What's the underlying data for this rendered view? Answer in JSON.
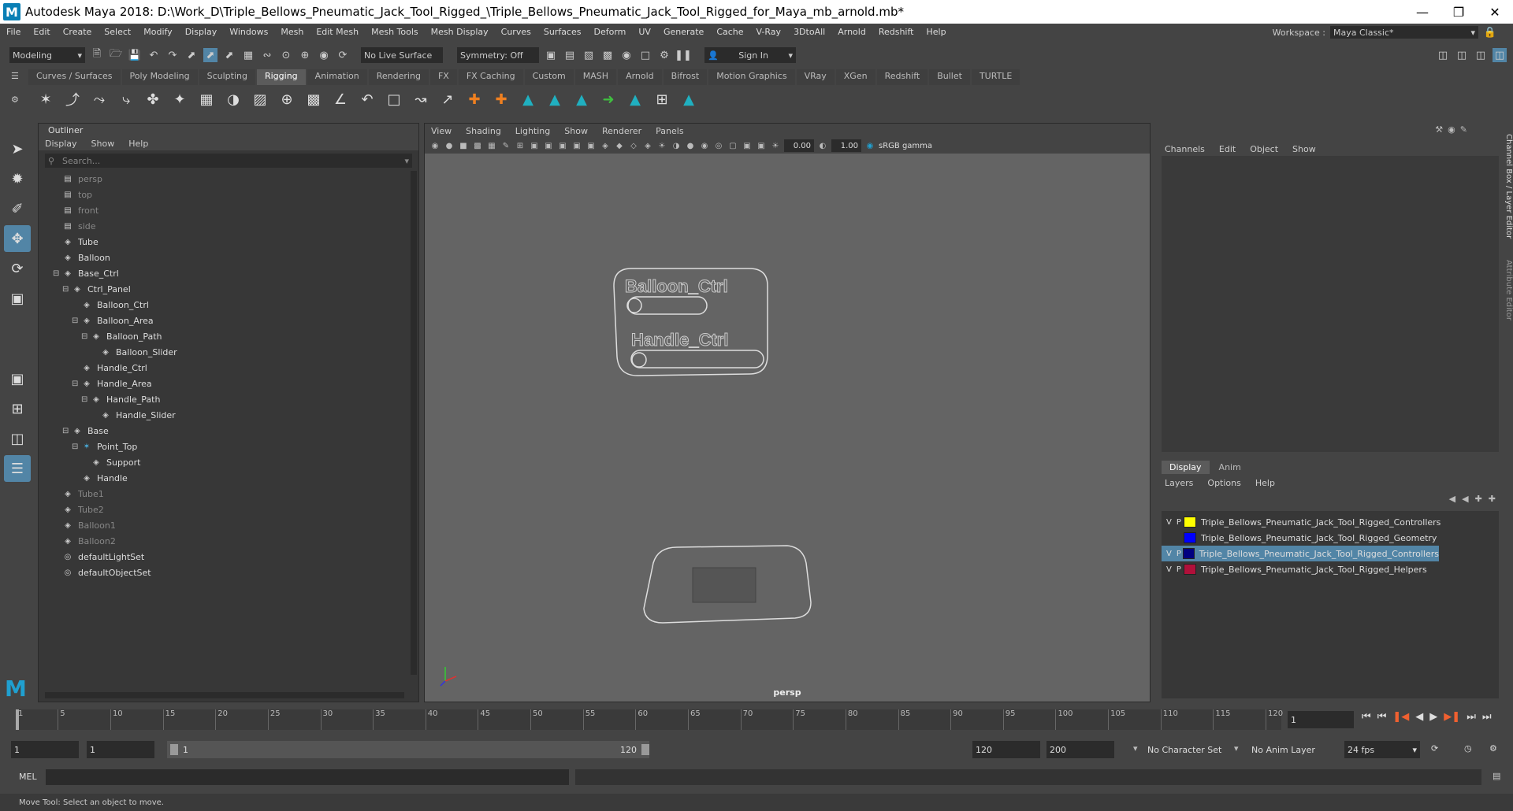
{
  "window": {
    "title": "Autodesk Maya 2018: D:\\Work_D\\Triple_Bellows_Pneumatic_Jack_Tool_Rigged_\\Triple_Bellows_Pneumatic_Jack_Tool_Rigged_for_Maya_mb_arnold.mb*",
    "logo": "M"
  },
  "menubar": [
    "File",
    "Edit",
    "Create",
    "Select",
    "Modify",
    "Display",
    "Windows",
    "Mesh",
    "Edit Mesh",
    "Mesh Tools",
    "Mesh Display",
    "Curves",
    "Surfaces",
    "Deform",
    "UV",
    "Generate",
    "Cache",
    "V-Ray",
    "3DtoAll",
    "Arnold",
    "Redshift",
    "Help"
  ],
  "workspace": {
    "label": "Workspace :",
    "value": "Maya Classic*"
  },
  "toolbar": {
    "mode": "Modeling",
    "live_surface": "No Live Surface",
    "symmetry": "Symmetry: Off",
    "sign_in": "Sign In"
  },
  "shelf_tabs": [
    "Curves / Surfaces",
    "Poly Modeling",
    "Sculpting",
    "Rigging",
    "Animation",
    "Rendering",
    "FX",
    "FX Caching",
    "Custom",
    "MASH",
    "Arnold",
    "Bifrost",
    "Motion Graphics",
    "VRay",
    "XGen",
    "Redshift",
    "Bullet",
    "TURTLE"
  ],
  "shelf_active": "Rigging",
  "outliner": {
    "title": "Outliner",
    "menu": [
      "Display",
      "Show",
      "Help"
    ],
    "search_placeholder": "Search...",
    "items": [
      {
        "label": "persp",
        "depth": 0,
        "dim": true,
        "icon": "camera-icon"
      },
      {
        "label": "top",
        "depth": 0,
        "dim": true,
        "icon": "camera-icon"
      },
      {
        "label": "front",
        "depth": 0,
        "dim": true,
        "icon": "camera-icon"
      },
      {
        "label": "side",
        "depth": 0,
        "dim": true,
        "icon": "camera-icon"
      },
      {
        "label": "Tube",
        "depth": 0,
        "dim": false,
        "icon": "transform-icon"
      },
      {
        "label": "Balloon",
        "depth": 0,
        "dim": false,
        "icon": "transform-icon"
      },
      {
        "label": "Base_Ctrl",
        "depth": 0,
        "dim": false,
        "icon": "transform-icon",
        "expander": true
      },
      {
        "label": "Ctrl_Panel",
        "depth": 1,
        "dim": false,
        "icon": "transform-icon",
        "expander": true
      },
      {
        "label": "Balloon_Ctrl",
        "depth": 2,
        "dim": false,
        "icon": "transform-icon"
      },
      {
        "label": "Balloon_Area",
        "depth": 2,
        "dim": false,
        "icon": "transform-icon",
        "expander": true
      },
      {
        "label": "Balloon_Path",
        "depth": 3,
        "dim": false,
        "icon": "transform-icon",
        "expander": true
      },
      {
        "label": "Balloon_Slider",
        "depth": 4,
        "dim": false,
        "icon": "transform-icon"
      },
      {
        "label": "Handle_Ctrl",
        "depth": 2,
        "dim": false,
        "icon": "transform-icon"
      },
      {
        "label": "Handle_Area",
        "depth": 2,
        "dim": false,
        "icon": "transform-icon",
        "expander": true
      },
      {
        "label": "Handle_Path",
        "depth": 3,
        "dim": false,
        "icon": "transform-icon",
        "expander": true
      },
      {
        "label": "Handle_Slider",
        "depth": 4,
        "dim": false,
        "icon": "transform-icon"
      },
      {
        "label": "Base",
        "depth": 1,
        "dim": false,
        "icon": "transform-icon",
        "expander": true
      },
      {
        "label": "Point_Top",
        "depth": 2,
        "dim": false,
        "icon": "locator-icon",
        "expander": true
      },
      {
        "label": "Support",
        "depth": 3,
        "dim": false,
        "icon": "transform-icon"
      },
      {
        "label": "Handle",
        "depth": 2,
        "dim": false,
        "icon": "transform-icon"
      },
      {
        "label": "Tube1",
        "depth": 0,
        "dim": true,
        "icon": "transform-icon"
      },
      {
        "label": "Tube2",
        "depth": 0,
        "dim": true,
        "icon": "transform-icon"
      },
      {
        "label": "Balloon1",
        "depth": 0,
        "dim": true,
        "icon": "transform-icon"
      },
      {
        "label": "Balloon2",
        "depth": 0,
        "dim": true,
        "icon": "transform-icon"
      },
      {
        "label": "defaultLightSet",
        "depth": 0,
        "dim": false,
        "icon": "set-icon"
      },
      {
        "label": "defaultObjectSet",
        "depth": 0,
        "dim": false,
        "icon": "set-icon"
      }
    ]
  },
  "viewport": {
    "menu": [
      "View",
      "Shading",
      "Lighting",
      "Show",
      "Renderer",
      "Panels"
    ],
    "exposure": "0.00",
    "gamma": "1.00",
    "colorspace": "sRGB gamma",
    "camera_label": "persp",
    "ctrl_text_1": "Balloon_Ctrl",
    "ctrl_text_2": "Handle_Ctrl"
  },
  "channelbox": {
    "menu": [
      "Channels",
      "Edit",
      "Object",
      "Show"
    ],
    "side_tab_1": "Channel Box / Layer Editor",
    "side_tab_2": "Attribute Editor"
  },
  "layers": {
    "tabs": [
      "Display",
      "Anim"
    ],
    "menu": [
      "Layers",
      "Options",
      "Help"
    ],
    "rows": [
      {
        "v": "V",
        "p": "P",
        "color": "#ffff00",
        "name": "Triple_Bellows_Pneumatic_Jack_Tool_Rigged_Controllers",
        "selected": false
      },
      {
        "v": "",
        "p": "",
        "color": "#0000ff",
        "name": "Triple_Bellows_Pneumatic_Jack_Tool_Rigged_Geometry",
        "selected": false
      },
      {
        "v": "V",
        "p": "P",
        "color": "#000080",
        "name": "Triple_Bellows_Pneumatic_Jack_Tool_Rigged_Controllers",
        "selected": true
      },
      {
        "v": "V",
        "p": "P",
        "color": "#b0103a",
        "name": "Triple_Bellows_Pneumatic_Jack_Tool_Rigged_Helpers",
        "selected": false
      }
    ]
  },
  "timeline": {
    "ticks": [
      "1",
      "5",
      "10",
      "15",
      "20",
      "25",
      "30",
      "35",
      "40",
      "45",
      "50",
      "55",
      "60",
      "65",
      "70",
      "75",
      "80",
      "85",
      "90",
      "95",
      "100",
      "105",
      "110",
      "115",
      "120"
    ],
    "current_frame": "1"
  },
  "range": {
    "start": "1",
    "anim_start": "1",
    "slider_start": "1",
    "slider_end": "120",
    "end": "120",
    "anim_end": "200",
    "character_set": "No Character Set",
    "anim_layer": "No Anim Layer",
    "fps": "24 fps"
  },
  "mel": {
    "label": "MEL"
  },
  "status": {
    "text": "Move Tool: Select an object to move."
  }
}
